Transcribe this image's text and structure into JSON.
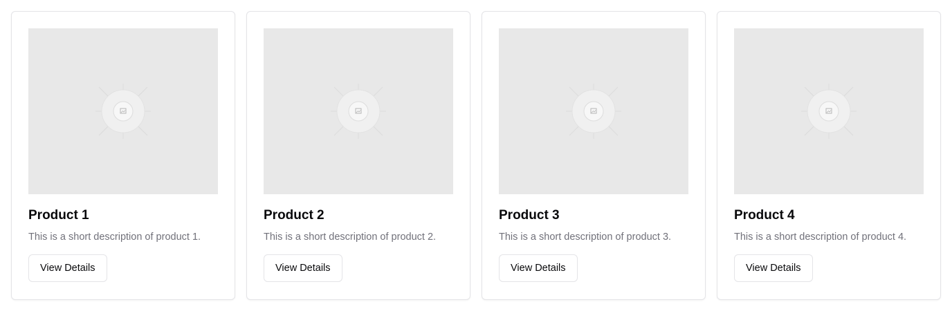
{
  "products": [
    {
      "name": "Product 1",
      "description": "This is a short description of product 1.",
      "button_label": "View Details",
      "image_icon": "image-placeholder-icon"
    },
    {
      "name": "Product 2",
      "description": "This is a short description of product 2.",
      "button_label": "View Details",
      "image_icon": "image-placeholder-icon"
    },
    {
      "name": "Product 3",
      "description": "This is a short description of product 3.",
      "button_label": "View Details",
      "image_icon": "image-placeholder-icon"
    },
    {
      "name": "Product 4",
      "description": "This is a short description of product 4.",
      "button_label": "View Details",
      "image_icon": "image-placeholder-icon"
    }
  ],
  "colors": {
    "placeholder_bg": "#e8e8e8",
    "border": "#e4e4e7",
    "muted_text": "#71717a",
    "heading_text": "#09090b"
  }
}
